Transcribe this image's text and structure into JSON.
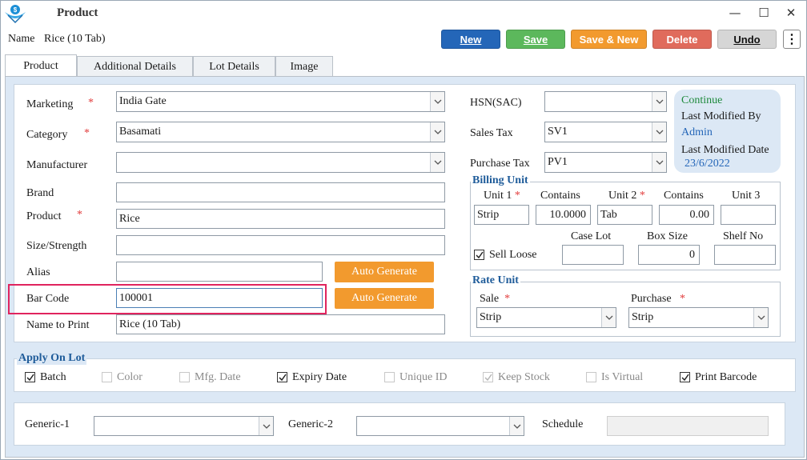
{
  "window": {
    "title": "Product",
    "controls": {
      "minimize": "—",
      "maximize": "☐",
      "close": "✕"
    }
  },
  "header": {
    "name_label": "Name",
    "name_value": "Rice (10 Tab)"
  },
  "toolbar": {
    "new_label": "New",
    "save_label": "Save",
    "save_new_label": "Save & New",
    "delete_label": "Delete",
    "undo_label": "Undo",
    "more_icon": "⋮"
  },
  "tabs": [
    "Product",
    "Additional Details",
    "Lot Details",
    "Image"
  ],
  "form": {
    "marketing": {
      "label": "Marketing",
      "value": "India Gate"
    },
    "category": {
      "label": "Category",
      "value": "Basamati"
    },
    "manufacturer": {
      "label": "Manufacturer",
      "value": ""
    },
    "brand": {
      "label": "Brand",
      "value": ""
    },
    "product": {
      "label": "Product",
      "value": "Rice"
    },
    "size_strength": {
      "label": "Size/Strength",
      "value": ""
    },
    "alias": {
      "label": "Alias",
      "value": ""
    },
    "bar_code": {
      "label": "Bar Code",
      "value": "100001"
    },
    "name_to_print": {
      "label": "Name to Print",
      "value": "Rice (10 Tab)"
    },
    "auto_generate_label": "Auto Generate",
    "required_mark": "*"
  },
  "tax": {
    "hsn": {
      "label": "HSN(SAC)",
      "value": ""
    },
    "sales_tax": {
      "label": "Sales Tax",
      "value": "SV1"
    },
    "purchase_tax": {
      "label": "Purchase Tax",
      "value": "PV1"
    }
  },
  "status": {
    "state": "Continue",
    "modified_by_label": "Last Modified By",
    "modified_by": "Admin",
    "modified_date_label": "Last Modified Date",
    "modified_date": "23/6/2022"
  },
  "billing_unit": {
    "title": "Billing Unit",
    "unit1_label": "Unit 1",
    "contains1_label": "Contains",
    "unit2_label": "Unit 2",
    "contains2_label": "Contains",
    "unit3_label": "Unit 3",
    "unit1": "Strip",
    "contains1": "10.0000",
    "unit2": "Tab",
    "contains2": "0.00",
    "unit3": "",
    "sell_loose_label": "Sell Loose",
    "case_lot_label": "Case Lot",
    "box_size_label": "Box Size",
    "shelf_no_label": "Shelf No",
    "case_lot": "",
    "box_size": "0",
    "shelf_no": ""
  },
  "rate_unit": {
    "title": "Rate Unit",
    "sale_label": "Sale",
    "purchase_label": "Purchase",
    "sale": "Strip",
    "purchase": "Strip"
  },
  "apply_on_lot": {
    "title": "Apply On Lot",
    "items": [
      {
        "label": "Batch",
        "checked": true,
        "enabled": true
      },
      {
        "label": "Color",
        "checked": false,
        "enabled": false
      },
      {
        "label": "Mfg. Date",
        "checked": false,
        "enabled": false
      },
      {
        "label": "Expiry Date",
        "checked": true,
        "enabled": true
      },
      {
        "label": "Unique ID",
        "checked": false,
        "enabled": false
      },
      {
        "label": "Keep Stock",
        "checked": true,
        "enabled": false
      },
      {
        "label": "Is Virtual",
        "checked": false,
        "enabled": false
      },
      {
        "label": "Print Barcode",
        "checked": true,
        "enabled": true
      }
    ]
  },
  "generics": {
    "generic1_label": "Generic-1",
    "generic1": "",
    "generic2_label": "Generic-2",
    "generic2": "",
    "schedule_label": "Schedule",
    "schedule": ""
  },
  "colors": {
    "new": "#2466b8",
    "save": "#5cb85c",
    "save_new": "#f29a2e",
    "delete": "#e06b5c",
    "undo": "#d6d6d6",
    "panel": "#dce8f5",
    "group_title": "#1f5c9a",
    "highlight": "#e0245e"
  }
}
